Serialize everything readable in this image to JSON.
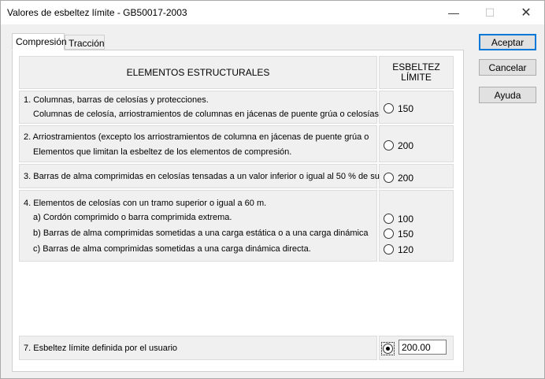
{
  "window": {
    "title": "Valores de esbeltez límite - GB50017-2003",
    "minimize_glyph": "—",
    "maximize_glyph": "☐",
    "close_glyph": "✕"
  },
  "tabs": [
    {
      "label": "Compresión",
      "active": true
    },
    {
      "label": "Tracción",
      "active": false
    }
  ],
  "table": {
    "col_elements": "ELEMENTOS ESTRUCTURALES",
    "col_limit_line1": "ESBELTEZ",
    "col_limit_line2": "LÍMITE",
    "rows": [
      {
        "line1": "1. Columnas, barras de celosías y protecciones.",
        "line2": "Columnas de celosía, arriostramientos de columnas en jácenas de puente grúa o celosías",
        "options": [
          "150"
        ]
      },
      {
        "line1": "2. Arriostramientos (excepto los arriostramientos de columna en jácenas de puente grúa o",
        "line2": "Elementos que limitan la esbeltez de los elementos de compresión.",
        "options": [
          "200"
        ]
      },
      {
        "line1": "3. Barras de alma comprimidas en celosías tensadas a un valor inferior o igual al 50 % de su",
        "options": [
          "200"
        ]
      },
      {
        "line1": "4. Elementos de celosías con un tramo superior o igual a 60 m.",
        "sub": [
          "a) Cordón comprimido o barra comprimida extrema.",
          "b) Barras de alma comprimidas sometidas a una carga estática o a una carga dinámica",
          "c) Barras de alma comprimidas sometidas a una carga dinámica directa."
        ],
        "options": [
          "100",
          "150",
          "120"
        ]
      },
      {
        "line1": "7. Esbeltez límite definida por el usuario",
        "value": "200.00"
      }
    ]
  },
  "buttons": {
    "accept": "Aceptar",
    "cancel": "Cancelar",
    "help": "Ayuda"
  },
  "colors": {
    "accent": "#0078d7"
  }
}
